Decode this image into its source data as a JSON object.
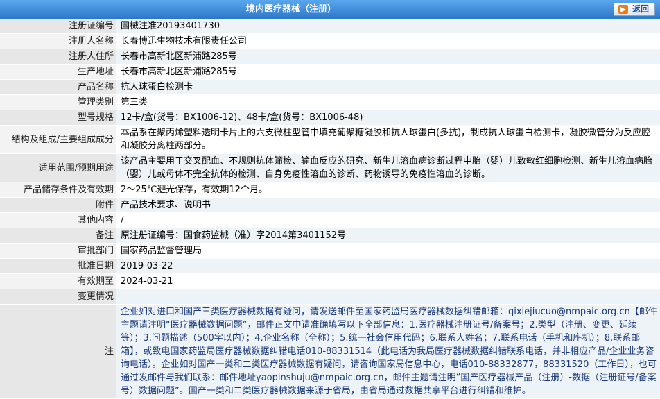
{
  "header": {
    "title": "境内医疗器械（注册）",
    "back_label": "返回"
  },
  "rows": [
    {
      "label": "注册证编号",
      "value": "国械注准20193401730"
    },
    {
      "label": "注册人名称",
      "value": "长春博迅生物技术有限责任公司"
    },
    {
      "label": "注册人住所",
      "value": "长春市高新北区新浦路285号"
    },
    {
      "label": "生产地址",
      "value": "长春市高新北区新浦路285号"
    },
    {
      "label": "产品名称",
      "value": "抗人球蛋白检测卡"
    },
    {
      "label": "管理类别",
      "value": "第三类"
    },
    {
      "label": "型号规格",
      "value": "12卡/盒(货号：BX1006-12)、48卡/盒(货号：BX1006-48)"
    },
    {
      "label": "结构及组成/主要组成成分",
      "value": "本品系在聚丙烯塑料透明卡片上的六支微柱型管中填充葡聚糖凝胶和抗人球蛋白(多抗)，制成抗人球蛋白检测卡，凝胶微管分为反应腔和凝胶分离柱两部分。"
    },
    {
      "label": "适用范围/预期用途",
      "value": "该产品主要用于交叉配血、不规则抗体筛检、输血反应的研究、新生儿溶血病诊断过程中胎（婴）儿致敏红细胞检测、新生儿溶血病胎（婴）儿或母体不完全抗体的检测、自身免疫性溶血的诊断、药物诱导的免疫性溶血的诊断。"
    },
    {
      "label": "产品储存条件及有效期",
      "value": "2～25℃避光保存，有效期12个月。"
    },
    {
      "label": "附件",
      "value": "产品技术要求、说明书"
    },
    {
      "label": "其他内容",
      "value": "/"
    },
    {
      "label": "备注",
      "value": "原注册证编号：国食药监械（准）字2014第3401152号"
    },
    {
      "label": "审批部门",
      "value": "国家药品监督管理局"
    },
    {
      "label": "批准日期",
      "value": "2019-03-22"
    },
    {
      "label": "有效期至",
      "value": "2024-03-21"
    },
    {
      "label": "变更情况",
      "value": ""
    }
  ],
  "note": {
    "label": "注",
    "text": "企业如对进口和国产三类医疗器械数据有疑问，请发送邮件至国家药监局医疗器械数据纠错邮箱：qixiejiucuo@nmpaic.org.cn【邮件主题请注明“医疗器械数据问题”，邮件正文中请准确填写以下全部信息：1.医疗器械注册证号/备案号；2.类型（注册、变更、延续等）；3.问题描述（500字以内）；4.企业名称（全称）；5.统一社会信用代码；6.联系人姓名；7.联系电话（手机和座机）；8.联系邮箱】，或致电国家药监局医疗器械数据纠错电话010-88331514（此电话为我局医疗器械数据纠错联系电话，并非相应产品/企业业务咨询电话）。企业如对国产一类和二类医疗器械数据有疑问，请咨询国家局信息中心，电话010-88332877，88331520（工作日），也可通过发邮件与我们联系：邮件地址yaopinshuju@nmpaic.org.cn，邮件主题请注明“国产医疗器械产品（注册）-数据（注册证号/备案号）数据问题”。国产一类和二类医疗器械数据来源于省局，由省局通过数据共享平台进行纠错和维护。"
  }
}
